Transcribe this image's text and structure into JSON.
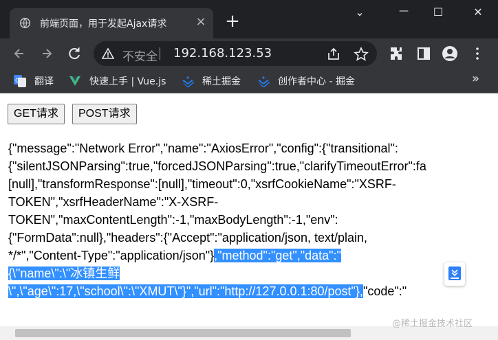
{
  "browser": {
    "tab_title": "前端页面，用于发起Ajax请求",
    "tab_close": "×",
    "new_tab": "+",
    "window_controls": {
      "dropdown": "⌄",
      "minimize": "—",
      "maximize": "☐",
      "close": "✕"
    },
    "not_secure_label": "不安全",
    "url": "192.168.123.53",
    "bookmarks": [
      {
        "label": "翻译",
        "icon": "google-translate-icon"
      },
      {
        "label": "快速上手 | Vue.js",
        "icon": "vue-icon"
      },
      {
        "label": "稀土掘金",
        "icon": "juejin-icon"
      },
      {
        "label": "创作者中心 - 掘金",
        "icon": "juejin-icon"
      }
    ],
    "bookmarks_more": "»"
  },
  "page": {
    "get_button": "GET请求",
    "post_button": "POST请求",
    "output_lines": [
      {
        "normal": "{\"message\":\"Network Error\",\"name\":\"AxiosError\",\"config\":{\"transitional\":",
        "highlight": "",
        "tail": ""
      },
      {
        "normal": "{\"silentJSONParsing\":true,\"forcedJSONParsing\":true,\"clarifyTimeoutError\":fa",
        "highlight": "",
        "tail": ""
      },
      {
        "normal": "[null],\"transformResponse\":[null],\"timeout\":0,\"xsrfCookieName\":\"XSRF-",
        "highlight": "",
        "tail": ""
      },
      {
        "normal": "TOKEN\",\"xsrfHeaderName\":\"X-XSRF-",
        "highlight": "",
        "tail": ""
      },
      {
        "normal": "TOKEN\",\"maxContentLength\":-1,\"maxBodyLength\":-1,\"env\":",
        "highlight": "",
        "tail": ""
      },
      {
        "normal": "{\"FormData\":null},\"headers\":{\"Accept\":\"application/json, text/plain,",
        "highlight": "",
        "tail": ""
      },
      {
        "normal": "*/*\",\"Content-Type\":\"application/json\"}",
        "highlight": ",\"method\":\"get\",\"data\":\"",
        "tail": ""
      },
      {
        "normal": "",
        "highlight": "{\\\"name\\\":\\\"冰镇生鲜",
        "tail": ""
      },
      {
        "normal": "",
        "highlight": "\\\",\\\"age\\\":17,\\\"school\\\":\\\"XMUT\\\"}\",\"url\":\"http://127.0.0.1:80/post\"},",
        "tail": "\"code\":\""
      }
    ],
    "watermark": "@稀土掘金技术社区"
  },
  "colors": {
    "titlebar": "#202124",
    "toolbar": "#35363a",
    "selection": "#3390ff"
  }
}
